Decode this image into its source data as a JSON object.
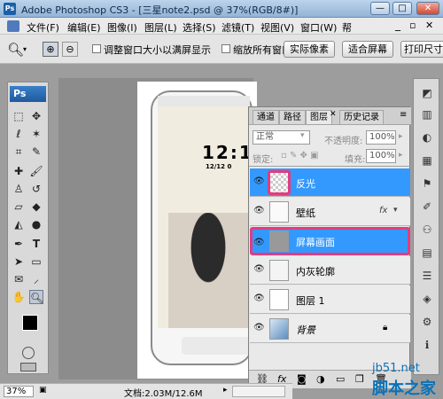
{
  "titlebar": {
    "title": "Adobe Photoshop CS3 - [三星note2.psd @ 37%(RGB/8#)]",
    "min": "—",
    "max": "□",
    "close": "✕"
  },
  "menu": [
    "文件(F)",
    "编辑(E)",
    "图像(I)",
    "图层(L)",
    "选择(S)",
    "滤镜(T)",
    "视图(V)",
    "窗口(W)",
    "帮"
  ],
  "options": {
    "resize_windows": "调整窗口大小以满屏显示",
    "zoom_all": "缩放所有窗口",
    "actual_pixels": "实际像素",
    "fit_screen": "适合屏幕",
    "print_size": "打印尺寸"
  },
  "toolbox": {
    "logo": "Ps"
  },
  "canvas": {
    "clock": "12:1",
    "date": "12/12  0"
  },
  "layers_panel": {
    "tabs": [
      "通道",
      "路径",
      "图层",
      "历史记录"
    ],
    "blend_mode": "正常",
    "opacity_label": "不透明度:",
    "opacity": "100%",
    "lock_label": "锁定:",
    "fill_label": "填充:",
    "fill": "100%",
    "layers": [
      {
        "name": "反光",
        "selected": true
      },
      {
        "name": "壁纸",
        "selected": false,
        "fx": "fx"
      },
      {
        "name": "屏幕画面",
        "selected": true
      },
      {
        "name": "内灰轮廓",
        "selected": false
      },
      {
        "name": "图层 1",
        "selected": false
      },
      {
        "name": "背景",
        "selected": false,
        "locked": true
      }
    ]
  },
  "status": {
    "zoom": "37%",
    "doc": "文档:2.03M/12.6M"
  },
  "watermark": {
    "site": "jb51.net",
    "name": "脚本之家"
  }
}
